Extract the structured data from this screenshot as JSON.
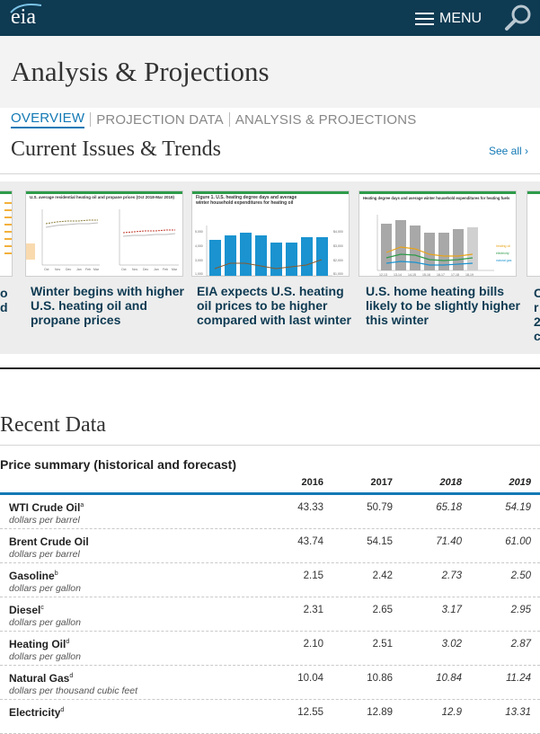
{
  "header": {
    "logo_text": "eia",
    "menu_label": "MENU",
    "brand_color": "#0e3a52",
    "accent_color": "#1379b5",
    "search_icon": "search-icon",
    "menu_icon": "hamburger-icon"
  },
  "page": {
    "title": "Analysis & Projections"
  },
  "tabs": [
    {
      "label": "OVERVIEW",
      "active": true
    },
    {
      "label": "PROJECTION DATA",
      "active": false
    },
    {
      "label": "ANALYSIS & PROJECTIONS",
      "active": false
    }
  ],
  "current_issues": {
    "title": "Current Issues & Trends",
    "see_all": "See all ›",
    "left_partial_caption": [
      "o",
      "d"
    ],
    "cards": [
      {
        "caption": "Winter begins with higher U.S. heating oil and propane prices",
        "chart_title": "U.S. average residential heating oil and propane prices (Oct 2018-Mar 2019)"
      },
      {
        "caption": "EIA expects U.S. heating oil prices to be higher compared with last winter",
        "chart_title": "Figure 1. U.S. heating degree days and average winter household expenditures for heating oil"
      },
      {
        "caption": "U.S. home heating bills likely to be slightly higher this winter",
        "chart_title": "Heating degree days and average winter household expenditures for heating fuels"
      }
    ],
    "right_partial_caption": [
      "C",
      "r",
      "2",
      "c"
    ]
  },
  "recent_data": {
    "title": "Recent Data",
    "table_title": "Price summary (historical and forecast)",
    "columns": [
      "2016",
      "2017",
      "2018",
      "2019"
    ],
    "forecast_columns": [
      false,
      false,
      true,
      true
    ],
    "rows": [
      {
        "name": "WTI Crude Oil",
        "note": "a",
        "unit": "dollars per barrel",
        "values": [
          "43.33",
          "50.79",
          "65.18",
          "54.19"
        ]
      },
      {
        "name": "Brent Crude Oil",
        "note": "",
        "unit": "dollars per barrel",
        "values": [
          "43.74",
          "54.15",
          "71.40",
          "61.00"
        ]
      },
      {
        "name": "Gasoline",
        "note": "b",
        "unit": "dollars per gallon",
        "values": [
          "2.15",
          "2.42",
          "2.73",
          "2.50"
        ]
      },
      {
        "name": "Diesel",
        "note": "c",
        "unit": "dollars per gallon",
        "values": [
          "2.31",
          "2.65",
          "3.17",
          "2.95"
        ]
      },
      {
        "name": "Heating Oil",
        "note": "d",
        "unit": "dollars per gallon",
        "values": [
          "2.10",
          "2.51",
          "3.02",
          "2.87"
        ]
      },
      {
        "name": "Natural Gas",
        "note": "d",
        "unit": "dollars per thousand cubic feet",
        "values": [
          "10.04",
          "10.86",
          "10.84",
          "11.24"
        ]
      },
      {
        "name": "Electricity",
        "note": "d",
        "unit": "",
        "values": [
          "12.55",
          "12.89",
          "12.9",
          "13.31"
        ]
      }
    ]
  }
}
